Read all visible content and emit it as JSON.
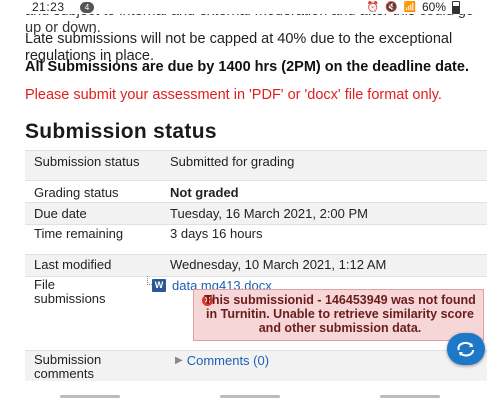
{
  "status_bar": {
    "time": "21:23",
    "notification_count": "4",
    "battery": "60%"
  },
  "intro": {
    "faded_text": "and subject to internal and external moderation and after this could go up or down.",
    "late_submissions": "Late submissions will not be capped at 40% due to the exceptional regulations in place.",
    "due_notice": "All Submissions are due by 1400 hrs (2PM) on the deadline date.",
    "format_notice": "Please submit your assessment in 'PDF' or 'docx' file format only."
  },
  "submission_status": {
    "heading": "Submission status",
    "rows": [
      {
        "label": "Submission status",
        "value": "Submitted for grading"
      },
      {
        "label": "Grading status",
        "value": "Not graded"
      },
      {
        "label": "Due date",
        "value": "Tuesday, 16 March 2021, 2:00 PM"
      },
      {
        "label": "Time remaining",
        "value": "3 days 16 hours"
      },
      {
        "label": "Last modified",
        "value": "Wednesday, 10 March 2021, 1:12 AM"
      },
      {
        "label": "File submissions",
        "value": ""
      },
      {
        "label": "Submission comments",
        "value": ""
      }
    ],
    "file": {
      "name": "data mg413.docx",
      "icon_letter": "W"
    },
    "error": {
      "icon": "close-icon",
      "message": "This submissionid - 146453949 was not found in Turnitin. Unable to retrieve similarity score and other submission data."
    },
    "comments_link": "Comments (0)"
  },
  "colors": {
    "link": "#1f5fb4",
    "error_bg": "#f6d6d6",
    "warning_red": "#e02020",
    "fab": "#1e78c8"
  }
}
